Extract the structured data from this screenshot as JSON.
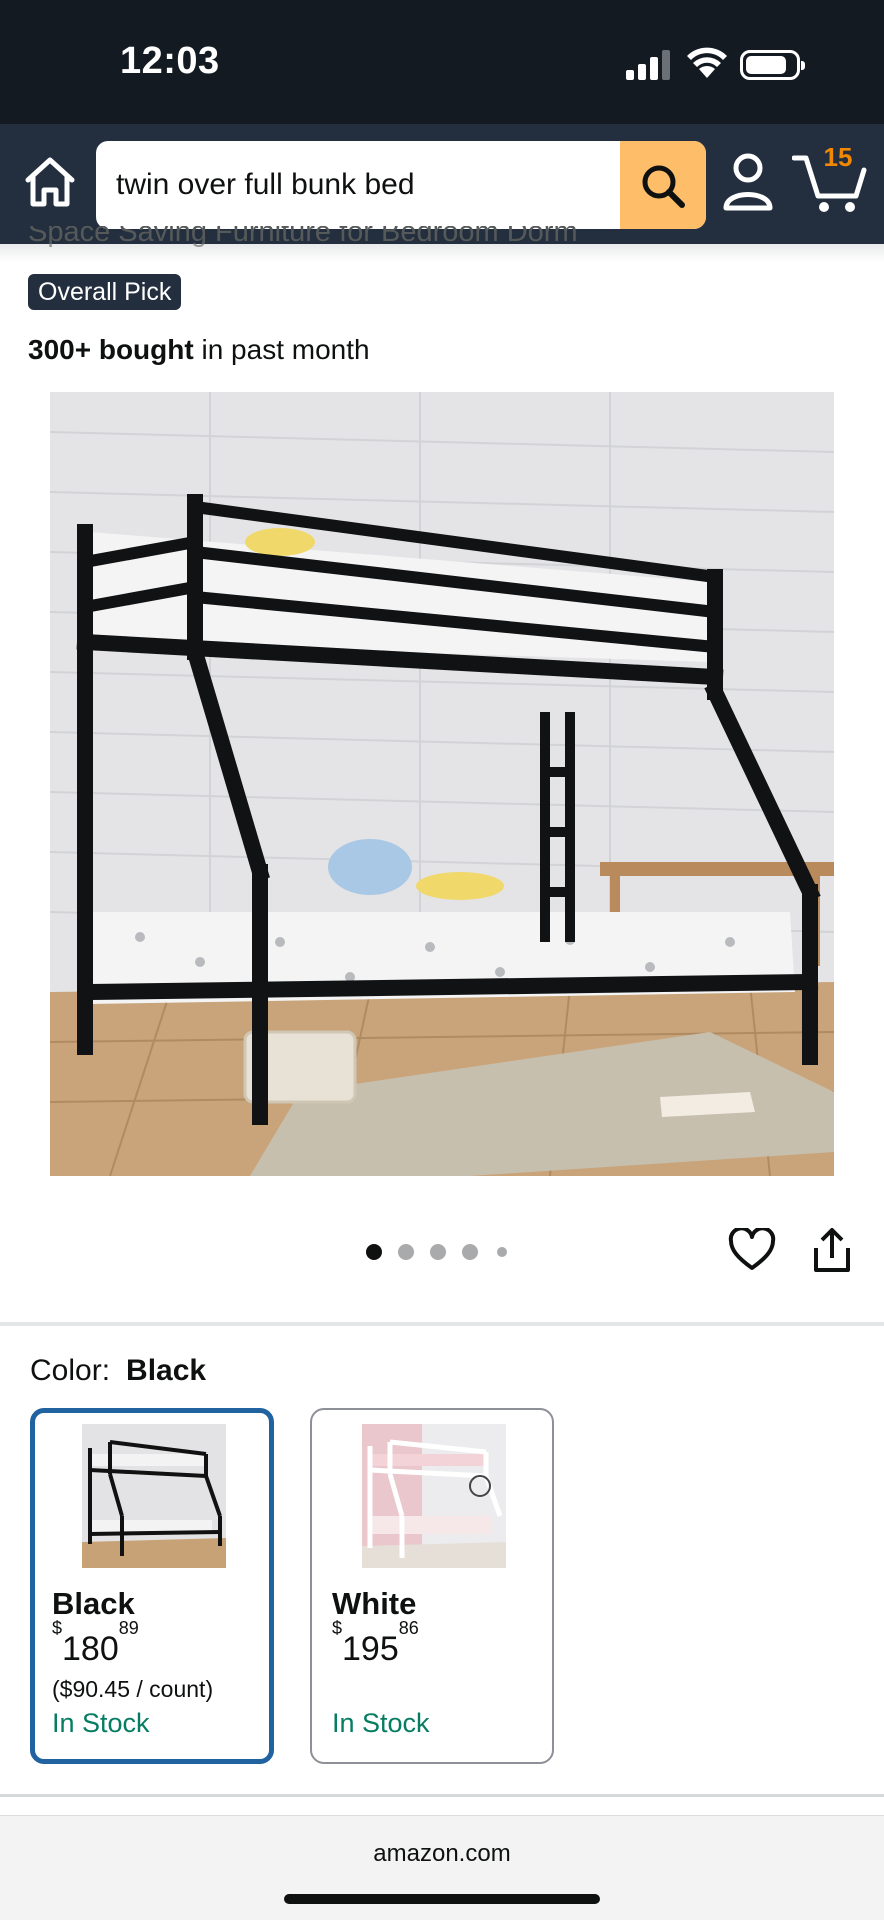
{
  "status_bar": {
    "time": "12:03",
    "battery": "full",
    "signal_bars": 4,
    "wifi": "on"
  },
  "header": {
    "search_value": "twin over full bunk bed",
    "cart_count": "15",
    "icons": [
      "home-icon",
      "search-icon",
      "account-icon",
      "cart-icon"
    ]
  },
  "product": {
    "partial_title": "Space Saving Furniture for Bedroom Dorm",
    "badge": "Overall Pick",
    "bought_bold": "300+ bought",
    "bought_rest": "in past month",
    "image_count": 5,
    "current_image": 1
  },
  "color": {
    "label": "Color:",
    "selected": "Black",
    "options": [
      {
        "name": "Black",
        "price_symbol": "$",
        "price_whole": "180",
        "price_fraction": "89",
        "unit_price": "($90.45 / count)",
        "stock": "In Stock"
      },
      {
        "name": "White",
        "price_symbol": "$",
        "price_whole": "195",
        "price_fraction": "86",
        "unit_price": "",
        "stock": "In Stock"
      }
    ]
  },
  "footer": {
    "url": "amazon.com"
  },
  "colors": {
    "nav_bg": "#232f3e",
    "status_bg": "#131a22",
    "search_button": "#febd69",
    "cart_count": "#f08804",
    "in_stock": "#067d62",
    "selected_border": "#2162a1"
  }
}
